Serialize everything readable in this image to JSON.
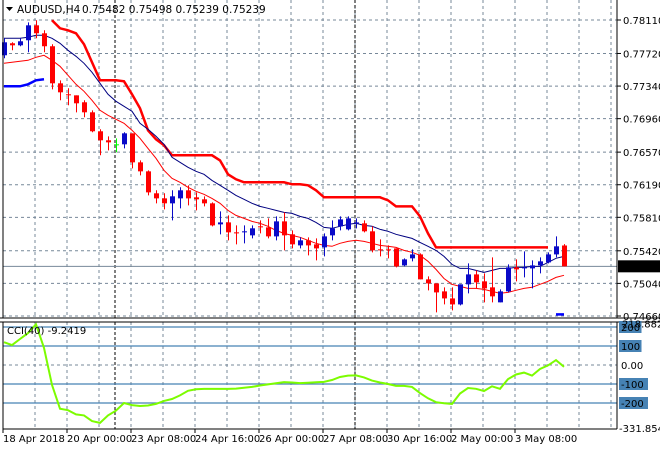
{
  "header": {
    "symbol": "AUDUSD,H4",
    "ohlc": "0.75482 0.75498 0.75239 0.75239",
    "menu_icon": "triangle-down-icon"
  },
  "price_axis": {
    "ticks": [
      "0.78110",
      "0.77720",
      "0.77340",
      "0.76960",
      "0.76570",
      "0.76190",
      "0.75810",
      "0.75420",
      "0.75040",
      "0.74660"
    ],
    "current_price": "0.75239",
    "current_price_value": 0.75239,
    "range": [
      0.7466,
      0.7811
    ]
  },
  "cci_panel": {
    "label": "CCI(40) -9.2419",
    "max_label": "218.8827",
    "min_label": "-331.8547",
    "range": [
      -331.8547,
      218.8827
    ],
    "levels": [
      {
        "value": 200,
        "label": "200",
        "boxed": true
      },
      {
        "value": 100,
        "label": "100",
        "boxed": true
      },
      {
        "value": 0,
        "label": "0.00",
        "boxed": false
      },
      {
        "value": -100,
        "label": "-100",
        "boxed": true
      },
      {
        "value": -200,
        "label": "-200",
        "boxed": true
      }
    ]
  },
  "time_axis": {
    "labels": [
      "18 Apr 2018",
      "20 Apr 00:00",
      "23 Apr 08:00",
      "24 Apr 16:00",
      "26 Apr 00:00",
      "27 Apr 08:00",
      "30 Apr 16:00",
      "2 May 00:00",
      "3 May 08:00"
    ],
    "bars_per_label": 8
  },
  "colors": {
    "bull": "#0a0ac8",
    "bear": "#ff0000",
    "doji": "#00ff00",
    "ma_fast": "#000080",
    "ma_slow": "#ff0000",
    "stop_down": "#ff0000",
    "stop_up": "#0000ff",
    "cci": "#7cfc00",
    "level": "#4682b4",
    "grid": "#778899",
    "price_box": "#000000"
  },
  "chart_data": {
    "type": "candlestick",
    "timeframe": "H4",
    "candles": [
      [
        0.77699,
        0.77897,
        0.77664,
        0.7785
      ],
      [
        0.77839,
        0.7785,
        0.77757,
        0.77815
      ],
      [
        0.77815,
        0.77897,
        0.77804,
        0.77862
      ],
      [
        0.77874,
        0.78083,
        0.77734,
        0.78048
      ],
      [
        0.78048,
        0.78107,
        0.77897,
        0.77955
      ],
      [
        0.77955,
        0.7799,
        0.77734,
        0.77804
      ],
      [
        0.77804,
        0.77827,
        0.77302,
        0.77372
      ],
      [
        0.77372,
        0.77407,
        0.77174,
        0.77267
      ],
      [
        0.77244,
        0.77314,
        0.77116,
        0.77232
      ],
      [
        0.77232,
        0.77232,
        0.77034,
        0.77139
      ],
      [
        0.77151,
        0.77174,
        0.76976,
        0.77034
      ],
      [
        0.77034,
        0.77057,
        0.76801,
        0.76813
      ],
      [
        0.76813,
        0.76836,
        0.76533,
        0.76708
      ],
      [
        0.76708,
        0.76754,
        0.76591,
        0.76684
      ],
      [
        0.76661,
        0.76731,
        0.76568,
        0.76661
      ],
      [
        0.76661,
        0.76801,
        0.76614,
        0.76789
      ],
      [
        0.76789,
        0.76789,
        0.76381,
        0.76451
      ],
      [
        0.76451,
        0.76474,
        0.76299,
        0.76346
      ],
      [
        0.76346,
        0.76358,
        0.76066,
        0.76101
      ],
      [
        0.7609,
        0.76125,
        0.75973,
        0.76031
      ],
      [
        0.76031,
        0.7609,
        0.75903,
        0.75973
      ],
      [
        0.75973,
        0.76125,
        0.75775,
        0.76055
      ],
      [
        0.76031,
        0.7616,
        0.75915,
        0.76125
      ],
      [
        0.76125,
        0.76183,
        0.7595,
        0.76031
      ],
      [
        0.76043,
        0.76101,
        0.75891,
        0.7602
      ],
      [
        0.7602,
        0.76055,
        0.75938,
        0.75973
      ],
      [
        0.75973,
        0.75985,
        0.75705,
        0.75716
      ],
      [
        0.75728,
        0.7588,
        0.75612,
        0.75751
      ],
      [
        0.75751,
        0.75833,
        0.75542,
        0.75635
      ],
      [
        0.75635,
        0.75716,
        0.75495,
        0.75623
      ],
      [
        0.75635,
        0.75716,
        0.75507,
        0.75647
      ],
      [
        0.756,
        0.75716,
        0.75565,
        0.75682
      ],
      [
        0.75705,
        0.75775,
        0.75623,
        0.75693
      ],
      [
        0.75693,
        0.75798,
        0.75565,
        0.75588
      ],
      [
        0.75588,
        0.75821,
        0.75542,
        0.75763
      ],
      [
        0.75763,
        0.75868,
        0.75425,
        0.756
      ],
      [
        0.75612,
        0.75658,
        0.75448,
        0.75495
      ],
      [
        0.75483,
        0.75577,
        0.75448,
        0.75542
      ],
      [
        0.75542,
        0.75577,
        0.75367,
        0.75483
      ],
      [
        0.75495,
        0.75565,
        0.75308,
        0.75448
      ],
      [
        0.7546,
        0.75623,
        0.75355,
        0.75588
      ],
      [
        0.756,
        0.75775,
        0.75542,
        0.75682
      ],
      [
        0.75705,
        0.75821,
        0.75658,
        0.75786
      ],
      [
        0.7567,
        0.75821,
        0.75658,
        0.75798
      ],
      [
        0.7574,
        0.75798,
        0.75682,
        0.75751
      ],
      [
        0.7574,
        0.75775,
        0.75635,
        0.75647
      ],
      [
        0.75647,
        0.75705,
        0.75402,
        0.75425
      ],
      [
        0.75437,
        0.75553,
        0.75355,
        0.75425
      ],
      [
        0.75437,
        0.75483,
        0.75332,
        0.75425
      ],
      [
        0.75448,
        0.75448,
        0.75227,
        0.75238
      ],
      [
        0.7525,
        0.75332,
        0.75238,
        0.7532
      ],
      [
        0.75332,
        0.75437,
        0.75297,
        0.75378
      ],
      [
        0.75378,
        0.7539,
        0.75087,
        0.75087
      ],
      [
        0.75087,
        0.75122,
        0.74959,
        0.7504
      ],
      [
        0.7504,
        0.7504,
        0.74702,
        0.74935
      ],
      [
        0.74947,
        0.74994,
        0.74795,
        0.74865
      ],
      [
        0.74865,
        0.74994,
        0.74725,
        0.74795
      ],
      [
        0.74795,
        0.75029,
        0.74784,
        0.75029
      ],
      [
        0.75029,
        0.75273,
        0.74924,
        0.75145
      ],
      [
        0.75145,
        0.75192,
        0.74982,
        0.75052
      ],
      [
        0.75064,
        0.75157,
        0.74819,
        0.74982
      ],
      [
        0.74994,
        0.75343,
        0.74819,
        0.74889
      ],
      [
        0.74819,
        0.7497,
        0.74819,
        0.74947
      ],
      [
        0.74947,
        0.75262,
        0.74935,
        0.75227
      ],
      [
        0.75227,
        0.7532,
        0.75064,
        0.75203
      ],
      [
        0.75215,
        0.75413,
        0.7511,
        0.75227
      ],
      [
        0.75215,
        0.75308,
        0.74982,
        0.7525
      ],
      [
        0.7525,
        0.75343,
        0.75157,
        0.75297
      ],
      [
        0.75285,
        0.75402,
        0.75273,
        0.75378
      ],
      [
        0.75378,
        0.75588,
        0.75343,
        0.75472
      ],
      [
        0.75482,
        0.75498,
        0.75239,
        0.75239
      ]
    ],
    "ma_fast": [
      0.77897,
      0.77897,
      0.77897,
      0.77909,
      0.77932,
      0.77932,
      0.77897,
      0.77839,
      0.77757,
      0.77687,
      0.77605,
      0.775,
      0.77372,
      0.77244,
      0.77162,
      0.77104,
      0.77046,
      0.76906,
      0.76836,
      0.76754,
      0.76661,
      0.7651,
      0.76451,
      0.76393,
      0.76346,
      0.76311,
      0.76241,
      0.76183,
      0.76125,
      0.76066,
      0.7602,
      0.75973,
      0.75938,
      0.75915,
      0.75891,
      0.75868,
      0.75856,
      0.75821,
      0.75798,
      0.75751,
      0.75693,
      0.75682,
      0.75705,
      0.75728,
      0.7574,
      0.75716,
      0.75705,
      0.7567,
      0.75647,
      0.75612,
      0.75588,
      0.75565,
      0.75518,
      0.75472,
      0.75425,
      0.75355,
      0.75262,
      0.75215,
      0.75215,
      0.75192,
      0.75168,
      0.75192,
      0.75215,
      0.75215,
      0.75227,
      0.75227,
      0.75238,
      0.75238,
      0.75285,
      0.75332,
      0.75355
    ],
    "ma_slow": [
      0.77605,
      0.77617,
      0.77629,
      0.7764,
      0.77675,
      0.77699,
      0.7764,
      0.7757,
      0.77466,
      0.77361,
      0.77279,
      0.77174,
      0.77057,
      0.76999,
      0.76953,
      0.76906,
      0.76824,
      0.76731,
      0.76614,
      0.76498,
      0.76358,
      0.76265,
      0.76218,
      0.7616,
      0.76113,
      0.76078,
      0.76031,
      0.75973,
      0.75891,
      0.75833,
      0.75798,
      0.75763,
      0.7574,
      0.75705,
      0.75658,
      0.75623,
      0.756,
      0.75577,
      0.75542,
      0.75507,
      0.75483,
      0.75472,
      0.75507,
      0.7553,
      0.75542,
      0.7553,
      0.75507,
      0.75483,
      0.75472,
      0.7546,
      0.75425,
      0.75402,
      0.75367,
      0.75297,
      0.75203,
      0.75097,
      0.75029,
      0.75005,
      0.74982,
      0.74982,
      0.7497,
      0.74947,
      0.74924,
      0.74935,
      0.74959,
      0.74982,
      0.74994,
      0.75029,
      0.75064,
      0.7511,
      0.75134
    ],
    "stop_down": [
      null,
      null,
      null,
      null,
      null,
      null,
      0.78107,
      0.78013,
      0.7799,
      0.77955,
      0.77827,
      0.77617,
      0.77407,
      0.77407,
      0.77407,
      0.77396,
      0.77244,
      0.77081,
      0.76824,
      0.76719,
      0.76649,
      0.76533,
      0.76533,
      0.76533,
      0.76533,
      0.76533,
      0.76533,
      0.76474,
      0.76311,
      0.76253,
      0.76218,
      0.76218,
      0.76218,
      0.76218,
      0.76218,
      0.76218,
      0.76195,
      0.76195,
      0.76183,
      0.76125,
      0.76043,
      0.76043,
      0.76043,
      0.76043,
      0.76043,
      0.76043,
      0.76043,
      0.76043,
      0.76008,
      0.75938,
      0.75938,
      0.75938,
      0.75821,
      0.75623,
      0.7546,
      0.7546,
      0.7546,
      0.7546,
      0.7546,
      0.7546,
      0.7546,
      0.7546,
      0.7546,
      0.7546,
      0.7546,
      0.7546,
      0.7546,
      0.7546,
      0.7546,
      null,
      null
    ],
    "stop_up": [
      0.77337,
      0.77337,
      0.77337,
      0.77361,
      0.77407,
      0.77419,
      null,
      null,
      null,
      null,
      null,
      null,
      null,
      null,
      null,
      null,
      null,
      null,
      null,
      null,
      null,
      null,
      null,
      null,
      null,
      null,
      null,
      null,
      null,
      null,
      null,
      null,
      null,
      null,
      null,
      null,
      null,
      null,
      null,
      null,
      null,
      null,
      null,
      null,
      null,
      null,
      null,
      null,
      null,
      null,
      null,
      null,
      null,
      null,
      null,
      null,
      null,
      null,
      null,
      null,
      null,
      null,
      null,
      null,
      null,
      null,
      null,
      null,
      null,
      0.74679,
      0.74679
    ],
    "cci": [
      120,
      105,
      137,
      168,
      214,
      90,
      -105,
      -230,
      -238,
      -260,
      -265,
      -295,
      -305,
      -265,
      -240,
      -200,
      -211,
      -216,
      -213,
      -205,
      -189,
      -179,
      -160,
      -136,
      -128,
      -126,
      -126,
      -126,
      -126,
      -124,
      -120,
      -115,
      -108,
      -102,
      -96,
      -90,
      -92,
      -95,
      -93,
      -91,
      -89,
      -79,
      -63,
      -56,
      -55,
      -65,
      -82,
      -92,
      -100,
      -110,
      -110,
      -115,
      -148,
      -175,
      -196,
      -201,
      -205,
      -150,
      -121,
      -125,
      -137,
      -112,
      -125,
      -74,
      -50,
      -40,
      -56,
      -21,
      -2,
      26,
      -9.2419
    ]
  }
}
